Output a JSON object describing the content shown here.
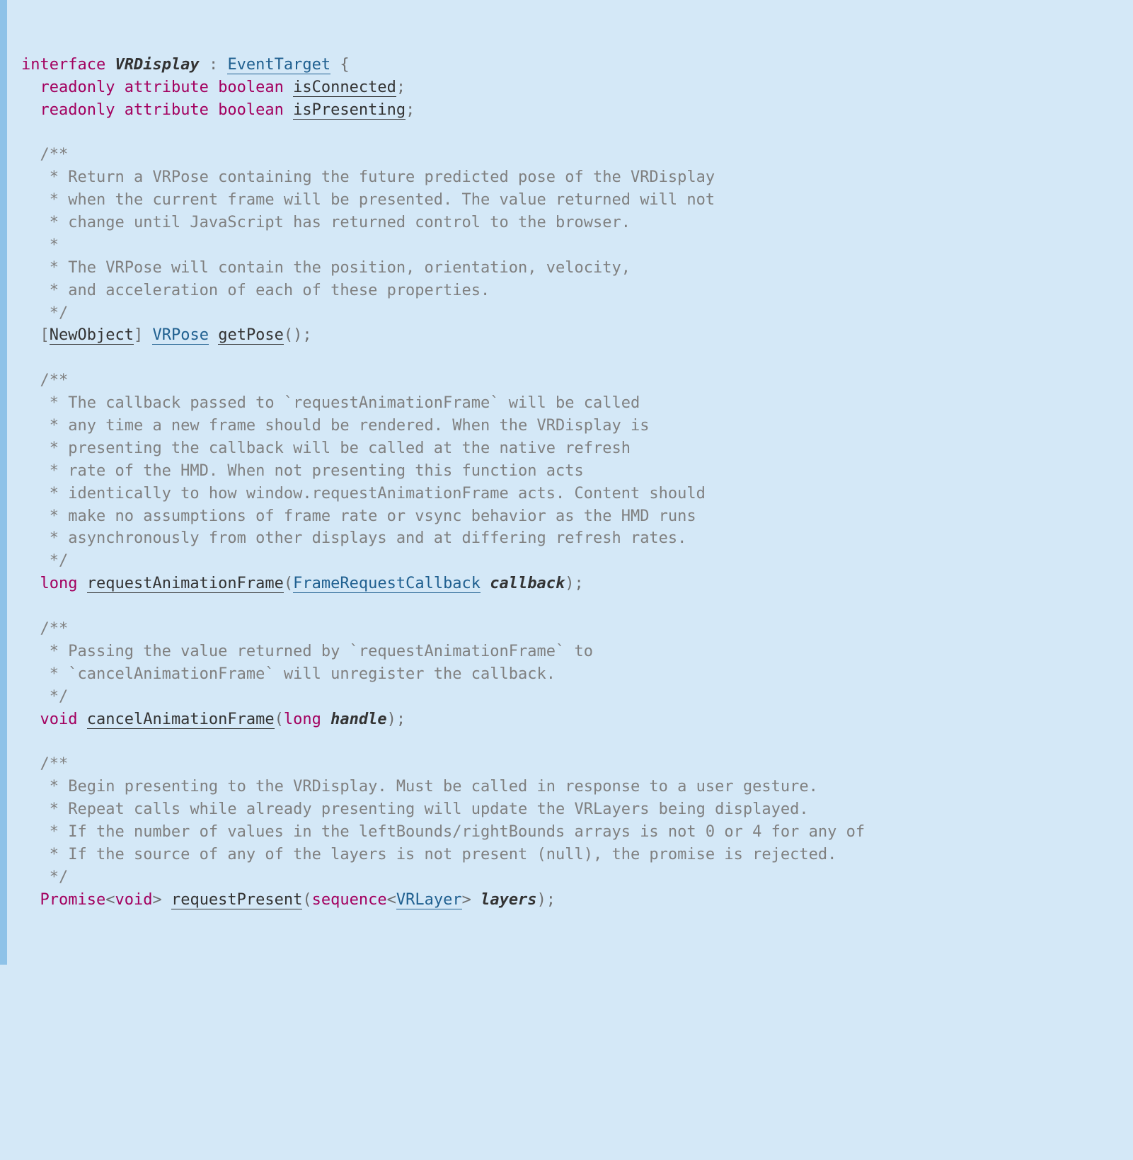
{
  "kw_interface": "interface",
  "kw_readonly": "readonly",
  "kw_attribute": "attribute",
  "kw_boolean": "boolean",
  "kw_long": "long",
  "kw_void": "void",
  "kw_sequence": "sequence",
  "kw_promise": "Promise",
  "iface": "VRDisplay",
  "extends": "EventTarget",
  "attr1": "isConnected",
  "attr2": "isPresenting",
  "extattr_newobject": "NewObject",
  "type_vrpose": "VRPose",
  "method_getpose": "getPose",
  "method_raf": "requestAnimationFrame",
  "type_frc": "FrameRequestCallback",
  "arg_callback": "callback",
  "method_caf": "cancelAnimationFrame",
  "arg_handle": "handle",
  "method_reqpresent": "requestPresent",
  "type_vrlayer": "VRLayer",
  "arg_layers": "layers",
  "cmt1_l1": "/**",
  "cmt1_l2": " * Return a VRPose containing the future predicted pose of the VRDisplay",
  "cmt1_l3": " * when the current frame will be presented. The value returned will not",
  "cmt1_l4": " * change until JavaScript has returned control to the browser.",
  "cmt1_l5": " *",
  "cmt1_l6": " * The VRPose will contain the position, orientation, velocity,",
  "cmt1_l7": " * and acceleration of each of these properties.",
  "cmt1_l8": " */",
  "cmt2_l1": "/**",
  "cmt2_l2": " * The callback passed to `requestAnimationFrame` will be called",
  "cmt2_l3": " * any time a new frame should be rendered. When the VRDisplay is",
  "cmt2_l4": " * presenting the callback will be called at the native refresh",
  "cmt2_l5": " * rate of the HMD. When not presenting this function acts",
  "cmt2_l6": " * identically to how window.requestAnimationFrame acts. Content should",
  "cmt2_l7": " * make no assumptions of frame rate or vsync behavior as the HMD runs",
  "cmt2_l8": " * asynchronously from other displays and at differing refresh rates.",
  "cmt2_l9": " */",
  "cmt3_l1": "/**",
  "cmt3_l2": " * Passing the value returned by `requestAnimationFrame` to",
  "cmt3_l3": " * `cancelAnimationFrame` will unregister the callback.",
  "cmt3_l4": " */",
  "cmt4_l1": "/**",
  "cmt4_l2": " * Begin presenting to the VRDisplay. Must be called in response to a user gesture.",
  "cmt4_l3": " * Repeat calls while already presenting will update the VRLayers being displayed.",
  "cmt4_l4": " * If the number of values in the leftBounds/rightBounds arrays is not 0 or 4 for any of",
  "cmt4_l5": " * If the source of any of the layers is not present (null), the promise is rejected.",
  "cmt4_l6": " */"
}
